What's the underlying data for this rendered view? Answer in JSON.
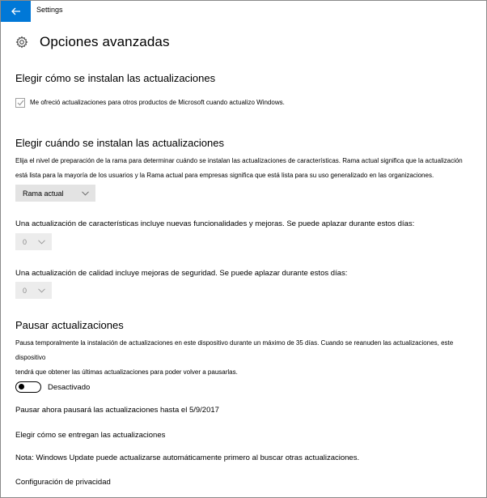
{
  "window": {
    "title": "Settings",
    "accent_color": "#0078d7"
  },
  "header": {
    "title": "Opciones avanzadas",
    "icon": "gear-icon"
  },
  "install": {
    "heading": "Elegir cómo se instalan las actualizaciones",
    "checkbox_label": "Me ofreció actualizaciones para otros productos de Microsoft cuando actualizo Windows.",
    "checkbox_checked": true
  },
  "when": {
    "heading": "Elegir cuándo se instalan las actualizaciones",
    "description_line1": "Elija el nivel de preparación de la rama para determinar cuándo se instalan las actualizaciones de características. Rama actual significa que la actualización",
    "description_line2": "está lista para la mayoría de los usuarios y la Rama actual para empresas significa que está lista para su uso generalizado en las organizaciones.",
    "branch_selected": "Rama actual",
    "feature_label": "Una actualización de características incluye nuevas funcionalidades y mejoras. Se puede aplazar durante estos días:",
    "feature_days": "0",
    "quality_label": "Una actualización de calidad incluye mejoras de seguridad. Se puede aplazar durante estos días:",
    "quality_days": "0"
  },
  "pause": {
    "heading": "Pausar actualizaciones",
    "description_line1": "Pausa temporalmente la instalación de actualizaciones en este dispositivo durante un máximo de 35 días. Cuando se reanuden las actualizaciones, este dispositivo",
    "description_line2": "tendrá que obtener las últimas actualizaciones para poder volver a pausarlas.",
    "toggle_state": "Desactivado",
    "toggle_on": false,
    "note": "Pausar ahora pausará las actualizaciones hasta el 5/9/2017"
  },
  "links": {
    "delivery": "Elegir cómo se entregan las actualizaciones",
    "note": "Nota: Windows Update puede actualizarse automáticamente primero al buscar otras actualizaciones.",
    "privacy": "Configuración de privacidad"
  }
}
